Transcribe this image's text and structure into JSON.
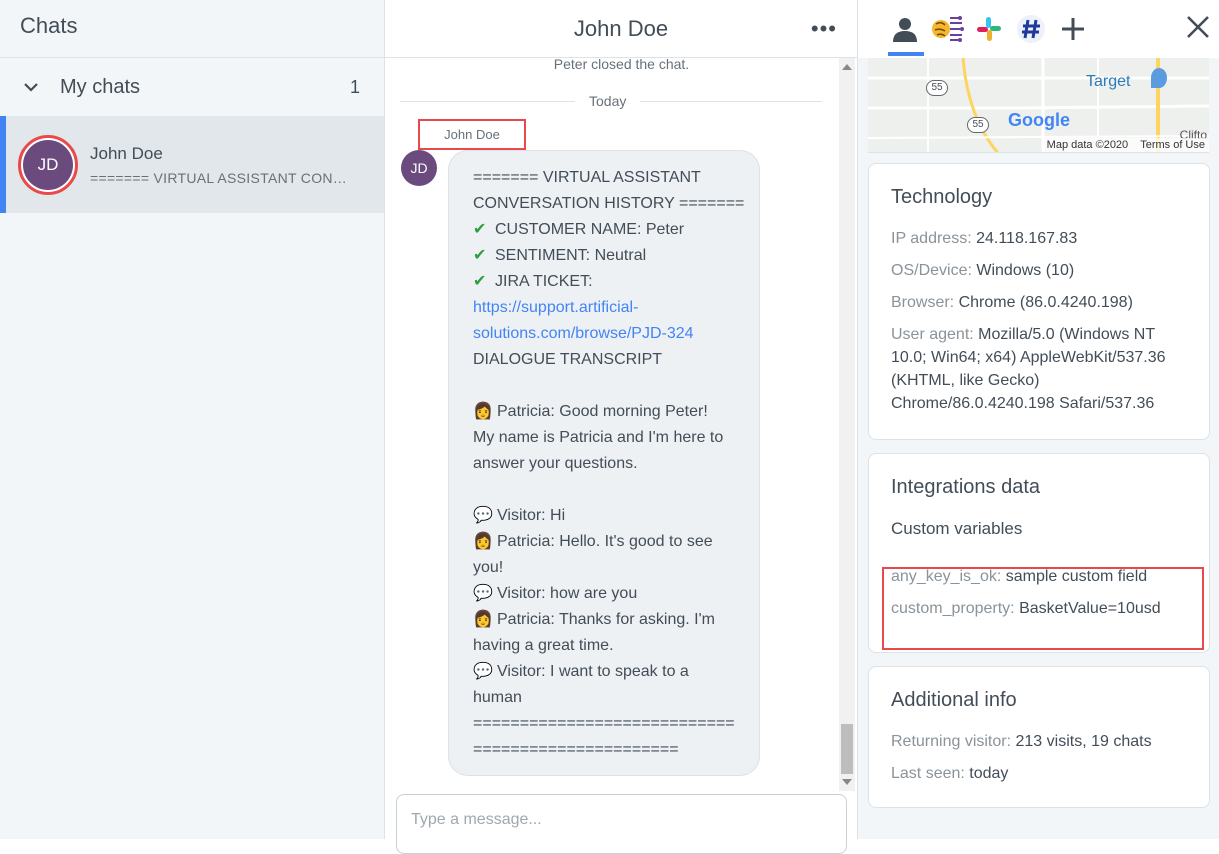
{
  "left": {
    "header_title": "Chats",
    "section_label": "My chats",
    "section_count": "1",
    "chat_item": {
      "avatar_initials": "JD",
      "name": "John Doe",
      "preview": "======= VIRTUAL ASSISTANT CONVERSATION HISTORY ======="
    }
  },
  "middle": {
    "title": "John Doe",
    "more_label": "•••",
    "system_message": "Peter closed the chat.",
    "divider_label": "Today",
    "author_label": "John Doe",
    "avatar_initials": "JD",
    "message_lines": {
      "l1": "======= VIRTUAL ASSISTANT",
      "l2": "CONVERSATION HISTORY =======",
      "l3": "CUSTOMER NAME: Peter",
      "l4": "SENTIMENT: Neutral",
      "l5": "JIRA TICKET:",
      "l6": "https://support.artificial-",
      "l7": "solutions.com/browse/PJD-324",
      "l8": "DIALOGUE TRANSCRIPT",
      "l9": "Patricia: Good morning Peter!",
      "l10": "My name is Patricia and I'm here to",
      "l11": "answer your questions.",
      "l12": "Visitor: Hi",
      "l13": "Patricia: Hello. It's good to see",
      "l14": "you!",
      "l15": "Visitor: how are you",
      "l16": "Patricia: Thanks for asking. I'm",
      "l17": "having a great time.",
      "l18": "Visitor: I want to speak to a",
      "l19": "human",
      "l20": "============================",
      "l21": "======================"
    },
    "composer_placeholder": "Type a message..."
  },
  "right": {
    "map": {
      "place_label": "Target",
      "logo_text": "Google",
      "road_55a": "55",
      "road_55b": "55",
      "attribution": "Map data ©2020",
      "terms": "Terms of Use",
      "edge_label": "Clifto"
    },
    "technology": {
      "title": "Technology",
      "ip_key": "IP address:",
      "ip_val": "24.118.167.83",
      "os_key": "OS/Device:",
      "os_val": "Windows (10)",
      "browser_key": "Browser:",
      "browser_val": "Chrome (86.0.4240.198)",
      "ua_key": "User agent:",
      "ua_val": "Mozilla/5.0 (Windows NT 10.0; Win64; x64) AppleWebKit/537.36 (KHTML, like Gecko) Chrome/86.0.4240.198 Safari/537.36"
    },
    "integrations": {
      "title": "Integrations data",
      "subtitle": "Custom variables",
      "var1_key": "any_key_is_ok:",
      "var1_val": "sample custom field",
      "var2_key": "custom_property:",
      "var2_val": "BasketValue=10usd"
    },
    "additional": {
      "title": "Additional info",
      "returning_key": "Returning visitor:",
      "returning_val": "213 visits, 19 chats",
      "lastseen_key": "Last seen:",
      "lastseen_val": "today"
    }
  },
  "colors": {
    "accent": "#4384f5",
    "highlight": "#e84a4a",
    "avatar": "#6b4a7e"
  }
}
